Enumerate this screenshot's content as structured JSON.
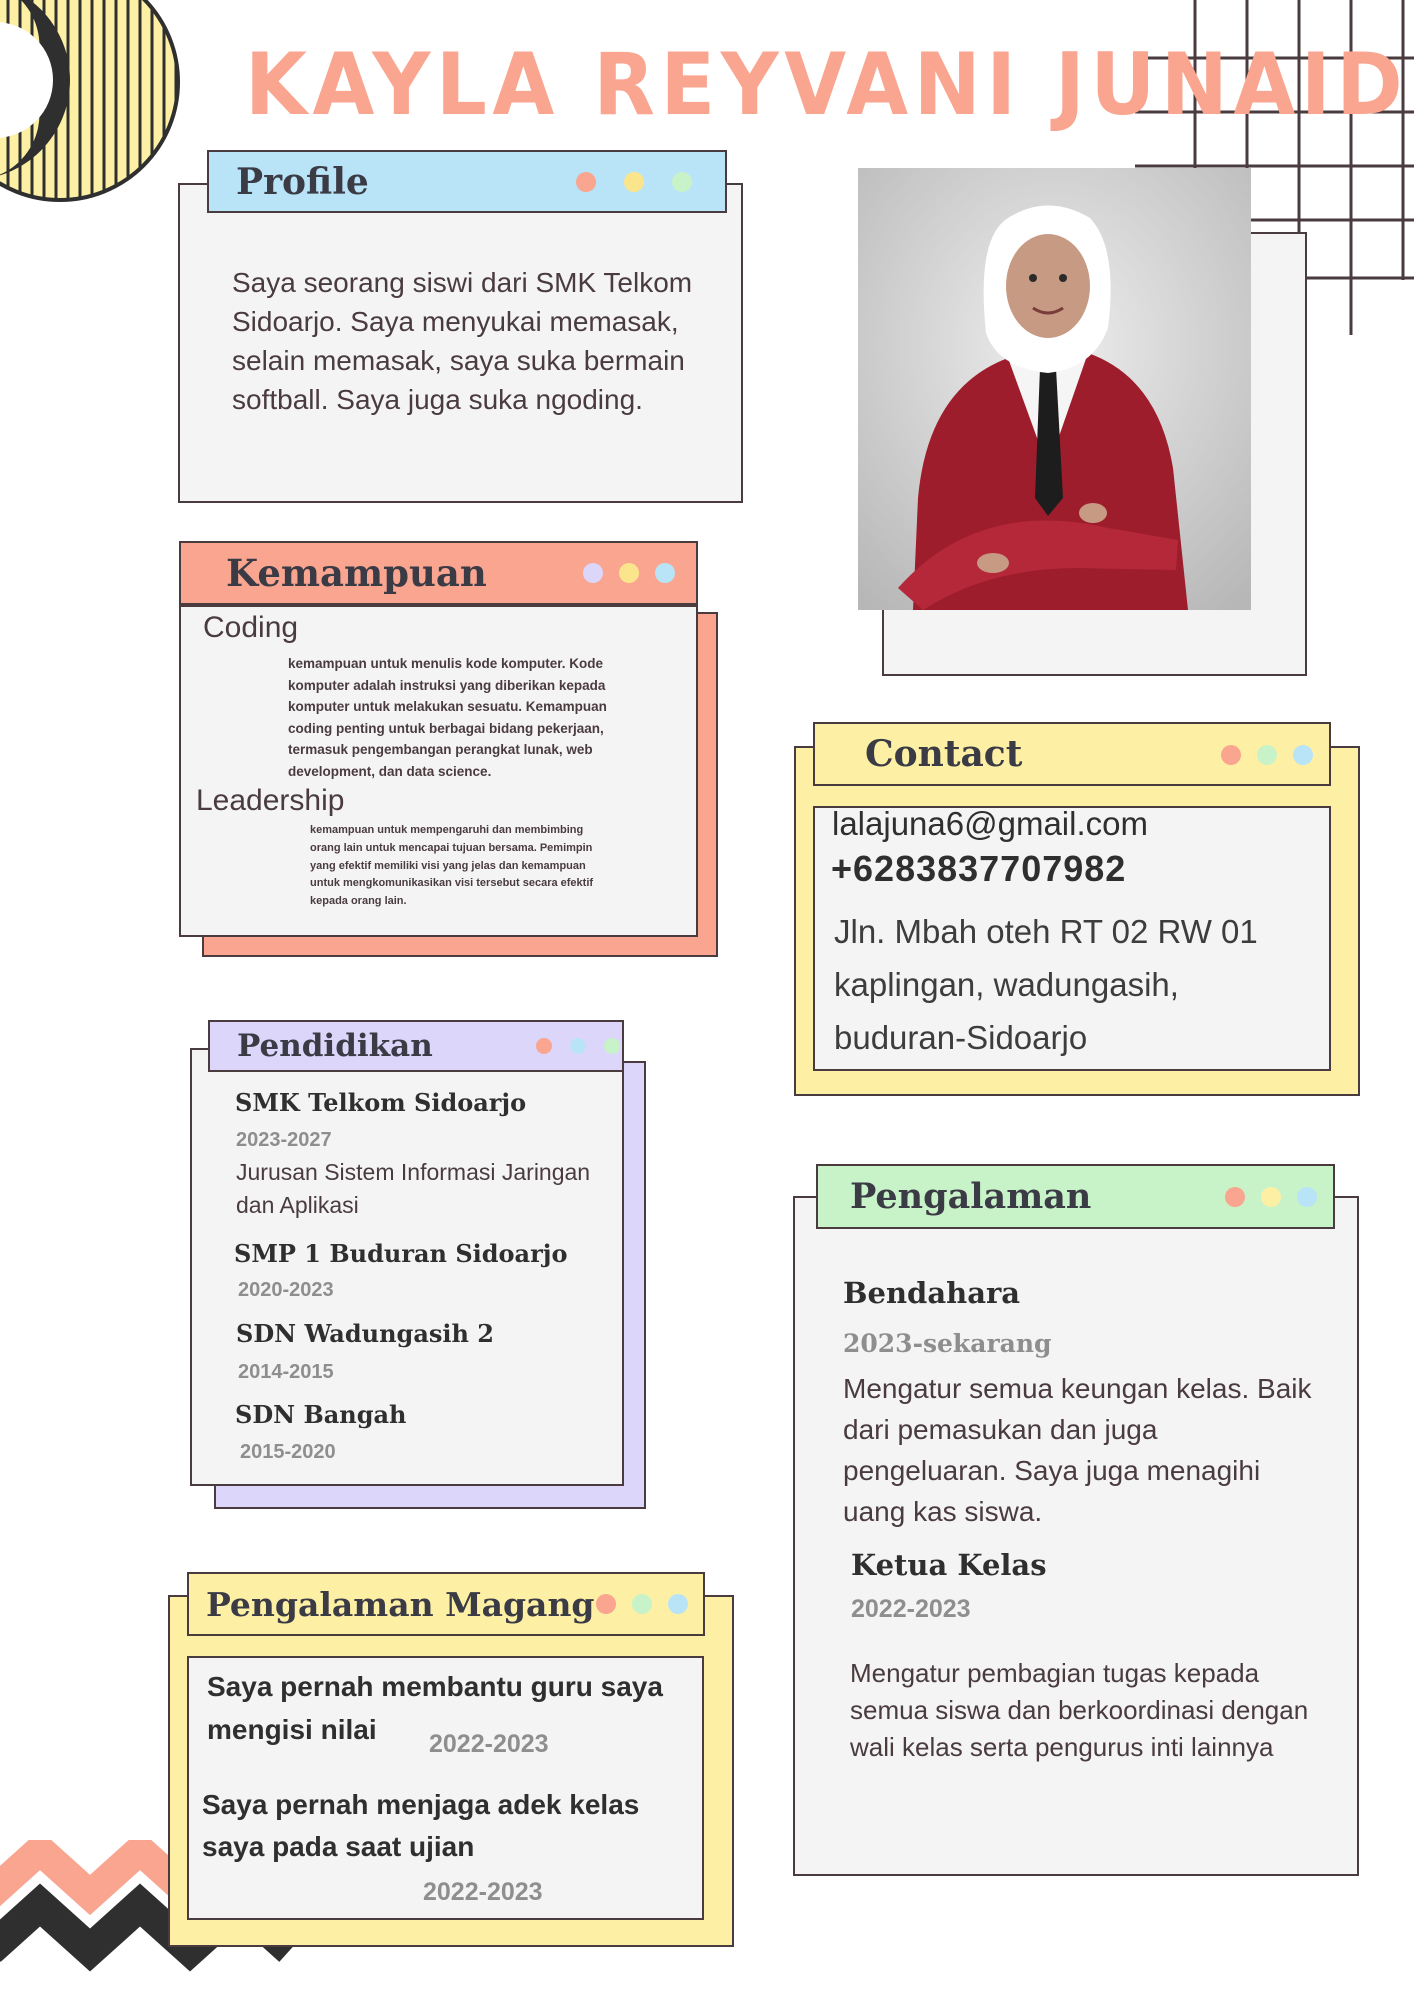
{
  "name": "KAYLA REYVANI JUNAIDI",
  "profile": {
    "title": "Profile",
    "text": "Saya seorang siswi dari SMK Telkom Sidoarjo. Saya menyukai memasak, selain memasak, saya suka bermain softball. Saya juga suka ngoding."
  },
  "skills": {
    "title": "Kemampuan",
    "items": [
      {
        "name": "Coding",
        "desc": "kemampuan untuk menulis kode komputer. Kode komputer adalah instruksi yang diberikan kepada komputer untuk melakukan sesuatu. Kemampuan coding penting untuk berbagai bidang pekerjaan, termasuk pengembangan perangkat lunak, web development, dan data science."
      },
      {
        "name": "Leadership",
        "desc": "kemampuan untuk mempengaruhi dan membimbing orang lain untuk mencapai tujuan bersama. Pemimpin yang efektif memiliki visi yang jelas dan kemampuan untuk mengkomunikasikan visi tersebut secara efektif kepada orang lain."
      }
    ]
  },
  "education": {
    "title": "Pendidikan",
    "items": [
      {
        "school": "SMK Telkom Sidoarjo",
        "years": "2023-2027",
        "detail": "Jurusan Sistem Informasi Jaringan dan Aplikasi"
      },
      {
        "school": "SMP 1 Buduran Sidoarjo",
        "years": "2020-2023"
      },
      {
        "school": "SDN Wadungasih 2",
        "years": "2014-2015"
      },
      {
        "school": "SDN Bangah",
        "years": "2015-2020"
      }
    ]
  },
  "internship": {
    "title": "Pengalaman Magang",
    "items": [
      {
        "text": "Saya pernah membantu guru saya mengisi nilai",
        "years": "2022-2023"
      },
      {
        "text": "Saya pernah menjaga adek kelas saya pada saat ujian",
        "years": "2022-2023"
      }
    ]
  },
  "contact": {
    "title": "Contact",
    "email": "lalajuna6@gmail.com",
    "phone": "+6283837707982",
    "address_lines": [
      "Jln. Mbah oteh RT 02 RW 01",
      "kaplingan, wadungasih,",
      "buduran-Sidoarjo"
    ]
  },
  "experience": {
    "title": "Pengalaman",
    "items": [
      {
        "role": "Bendahara",
        "years": "2023-sekarang",
        "desc": "Mengatur semua keungan kelas. Baik dari pemasukan dan juga pengeluaran. Saya juga menagihi uang kas siswa."
      },
      {
        "role": "Ketua Kelas",
        "years": "2022-2023",
        "desc": "Mengatur pembagian tugas kepada semua siswa dan berkoordinasi dengan wali kelas serta pengurus inti lainnya"
      }
    ]
  },
  "colors": {
    "salmon": "#f9a590",
    "blue": "#b9e3f7",
    "yellow": "#fdf0a4",
    "lavender": "#dcd6fb",
    "mint": "#c8f2c8",
    "dark": "#4a3b3f",
    "panel": "#f4f4f4"
  }
}
